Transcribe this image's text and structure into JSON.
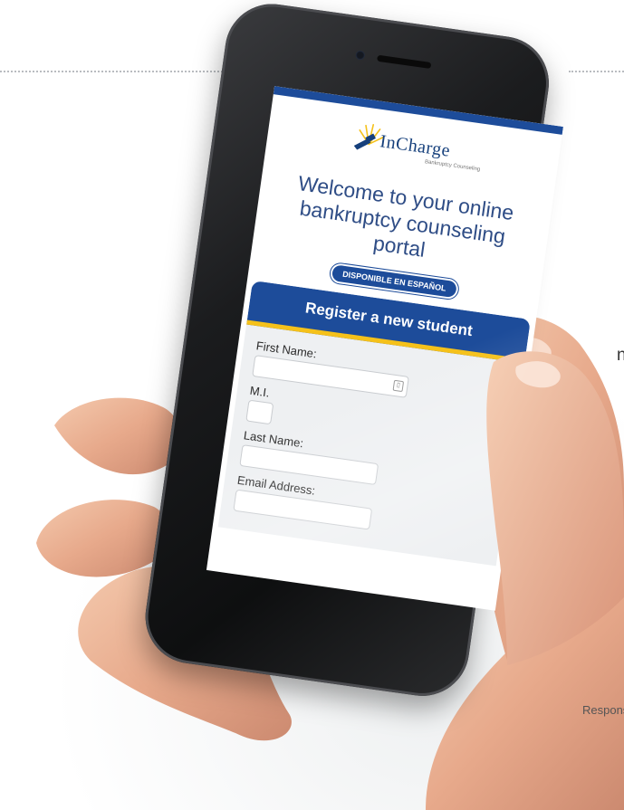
{
  "page": {
    "stray_char": "n",
    "corner_text": "Respons"
  },
  "brand": {
    "logo_word": "InCharge",
    "logo_tagline": "Bankruptcy Counseling",
    "primary_color": "#1d4c9a",
    "accent_color": "#f5c11a"
  },
  "screen": {
    "welcome_text": "Welcome to your online bankruptcy counseling portal",
    "spanish_badge": "DISPONIBLE EN ESPAÑOL",
    "register_title": "Register a new student",
    "form": {
      "first_name_label": "First Name:",
      "mi_label": "M.I.",
      "last_name_label": "Last Name:",
      "email_label": "Email Address:",
      "first_name_value": "",
      "mi_value": "",
      "last_name_value": "",
      "email_value": ""
    }
  },
  "icons": {
    "contact_card": "contact-card-icon",
    "logo_sunburst": "sunburst-gavel-icon"
  }
}
